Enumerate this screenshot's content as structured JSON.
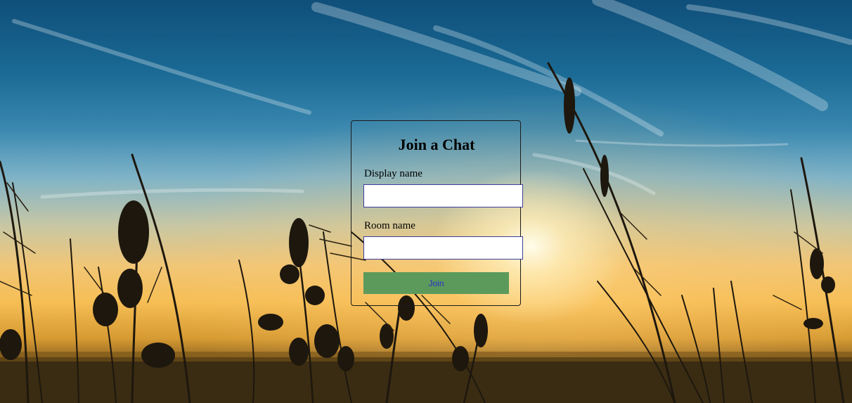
{
  "form": {
    "title": "Join a Chat",
    "display_name_label": "Display name",
    "display_name_value": "",
    "room_name_label": "Room name",
    "room_name_value": "",
    "join_label": "Join"
  },
  "background": {
    "description_icon": "sunset-meadow-grass-background"
  },
  "colors": {
    "join_button_bg": "#5c9a5c",
    "join_button_text": "#2b2bc9",
    "input_border": "#3d3d9e",
    "card_border": "#1b1b1b"
  }
}
